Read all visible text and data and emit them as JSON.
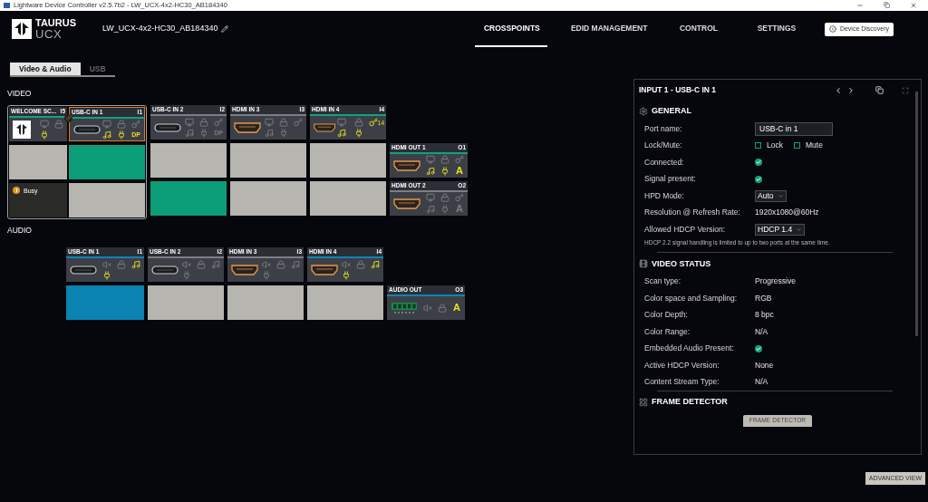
{
  "window": {
    "title": "Lightware Device Controller v2.5.7b2 - LW_UCX-4x2-HC30_AB184340"
  },
  "header": {
    "logo_top": "TAURUS",
    "logo_bottom": "UCX",
    "device_name": "LW_UCX-4x2-HC30_AB184340",
    "nav": [
      {
        "label": "CROSSPOINTS",
        "selected": true
      },
      {
        "label": "EDID MANAGEMENT",
        "selected": false
      },
      {
        "label": "CONTROL",
        "selected": false
      },
      {
        "label": "SETTINGS",
        "selected": false
      }
    ],
    "discovery_button": "Device Discovery"
  },
  "sub_tabs": [
    {
      "label": "Video & Audio",
      "selected": true
    },
    {
      "label": "USB",
      "selected": false
    }
  ],
  "video": {
    "label": "VIDEO",
    "inputs": [
      {
        "name": "WELCOME SC...",
        "id": "I5",
        "kind": "welcome",
        "signal": true,
        "selected": false,
        "icons": [
          {
            "kind": "monitor",
            "on": false
          },
          {
            "kind": "lock",
            "on": false
          },
          {
            "kind": "plug",
            "on": true
          }
        ]
      },
      {
        "name": "USB-C IN 1",
        "id": "I1",
        "kind": "usbc",
        "signal": true,
        "selected": true,
        "icons": [
          {
            "kind": "monitor",
            "on": false
          },
          {
            "kind": "lock",
            "on": false
          },
          {
            "kind": "key",
            "on": false
          },
          {
            "kind": "music",
            "on": true
          },
          {
            "kind": "plug",
            "on": true
          },
          {
            "kind": "dp",
            "on": true,
            "label": "DP"
          }
        ]
      },
      {
        "name": "USB-C IN 2",
        "id": "I2",
        "kind": "usbc",
        "signal": false,
        "selected": false,
        "icons": [
          {
            "kind": "monitor",
            "on": false
          },
          {
            "kind": "lock",
            "on": false
          },
          {
            "kind": "key",
            "on": false
          },
          {
            "kind": "music",
            "on": false
          },
          {
            "kind": "plug",
            "on": false
          },
          {
            "kind": "dp",
            "on": false,
            "label": "DP"
          }
        ]
      },
      {
        "name": "HDMI IN 3",
        "id": "I3",
        "kind": "hdmi",
        "signal": false,
        "selected": false,
        "icons": [
          {
            "kind": "monitor",
            "on": false
          },
          {
            "kind": "lock",
            "on": false
          },
          {
            "kind": "key",
            "on": false
          },
          {
            "kind": "music",
            "on": false
          },
          {
            "kind": "plug",
            "on": false
          }
        ]
      },
      {
        "name": "HDMI IN 4",
        "id": "I4",
        "kind": "hdmi",
        "signal": true,
        "selected": false,
        "icons": [
          {
            "kind": "monitor",
            "on": false
          },
          {
            "kind": "lock",
            "on": false
          },
          {
            "kind": "key",
            "on": true,
            "label": "14"
          },
          {
            "kind": "music",
            "on": true
          },
          {
            "kind": "plug",
            "on": true
          }
        ]
      }
    ],
    "outputs": [
      {
        "name": "HDMI OUT 1",
        "id": "O1",
        "kind": "hdmi",
        "signal": true,
        "selected": false,
        "icons": [
          {
            "kind": "monitor",
            "on": false
          },
          {
            "kind": "lock",
            "on": false
          },
          {
            "kind": "key",
            "on": false
          },
          {
            "kind": "music",
            "on": true
          },
          {
            "kind": "plug",
            "on": true
          },
          {
            "kind": "letter",
            "on": true,
            "label": "A"
          }
        ],
        "cells": [
          {
            "kind": "empty"
          },
          {
            "kind": "connected"
          },
          {
            "kind": "empty"
          },
          {
            "kind": "empty"
          },
          {
            "kind": "empty"
          }
        ]
      },
      {
        "name": "HDMI OUT 2",
        "id": "O2",
        "kind": "hdmi",
        "signal": false,
        "selected": false,
        "icons": [
          {
            "kind": "monitor",
            "on": false
          },
          {
            "kind": "lock",
            "on": false
          },
          {
            "kind": "key",
            "on": false
          },
          {
            "kind": "music",
            "on": false
          },
          {
            "kind": "plug",
            "on": false
          },
          {
            "kind": "letter",
            "on": false,
            "label": "A"
          }
        ],
        "cells": [
          {
            "kind": "busy",
            "label": "Busy"
          },
          {
            "kind": "empty"
          },
          {
            "kind": "connected"
          },
          {
            "kind": "empty"
          },
          {
            "kind": "empty"
          }
        ]
      }
    ]
  },
  "audio": {
    "label": "AUDIO",
    "inputs": [
      {
        "name": "USB-C IN 1",
        "id": "I1",
        "kind": "usbc",
        "signal": true,
        "selected": false,
        "icons": [
          {
            "kind": "mute",
            "on": false
          },
          {
            "kind": "lock",
            "on": false
          },
          {
            "kind": "music",
            "on": true
          },
          {
            "kind": "plug",
            "on": true
          }
        ]
      },
      {
        "name": "USB-C IN 2",
        "id": "I2",
        "kind": "usbc",
        "signal": false,
        "selected": false,
        "icons": [
          {
            "kind": "mute",
            "on": false
          },
          {
            "kind": "lock",
            "on": false
          },
          {
            "kind": "music",
            "on": false
          },
          {
            "kind": "plug",
            "on": false
          }
        ]
      },
      {
        "name": "HDMI IN 3",
        "id": "I3",
        "kind": "hdmi",
        "signal": false,
        "selected": false,
        "icons": [
          {
            "kind": "mute",
            "on": false
          },
          {
            "kind": "lock",
            "on": false
          },
          {
            "kind": "music",
            "on": false
          },
          {
            "kind": "plug",
            "on": false
          }
        ]
      },
      {
        "name": "HDMI IN 4",
        "id": "I4",
        "kind": "hdmi",
        "signal": true,
        "selected": false,
        "icons": [
          {
            "kind": "mute",
            "on": false
          },
          {
            "kind": "lock",
            "on": false
          },
          {
            "kind": "music",
            "on": true
          },
          {
            "kind": "plug",
            "on": true
          }
        ]
      }
    ],
    "outputs": [
      {
        "name": "AUDIO OUT",
        "id": "O3",
        "kind": "terminal",
        "signal": true,
        "selected": false,
        "icons": [
          {
            "kind": "mute",
            "on": false
          },
          {
            "kind": "lock",
            "on": false
          },
          {
            "kind": "letter",
            "on": true,
            "label": "A"
          }
        ],
        "cells": [
          {
            "kind": "connected"
          },
          {
            "kind": "empty"
          },
          {
            "kind": "empty"
          },
          {
            "kind": "empty"
          }
        ]
      }
    ]
  },
  "panel": {
    "title": "INPUT 1 - USB-C IN 1",
    "sections": [
      {
        "kind": "general",
        "title": "GENERAL",
        "rows": [
          {
            "kind": "input",
            "label": "Port name:",
            "value": "USB-C in 1"
          },
          {
            "kind": "checkboxes",
            "label": "Lock/Mute:",
            "options": [
              {
                "label": "Lock",
                "checked": false
              },
              {
                "label": "Mute",
                "checked": false
              }
            ]
          },
          {
            "kind": "status",
            "label": "Connected:",
            "on": true
          },
          {
            "kind": "status",
            "label": "Signal present:",
            "on": true
          },
          {
            "kind": "select",
            "label": "HPD Mode:",
            "value": "Auto"
          },
          {
            "kind": "text",
            "label": "Resolution @ Refresh Rate:",
            "value": "1920x1080@60Hz"
          },
          {
            "kind": "select",
            "label": "Allowed HDCP Version:",
            "value": "HDCP 1.4"
          }
        ],
        "note": "HDCP 2.2 signal handling is limited to up to two ports at the same time."
      },
      {
        "kind": "video",
        "title": "VIDEO STATUS",
        "rows": [
          {
            "kind": "text",
            "label": "Scan type:",
            "value": "Progressive"
          },
          {
            "kind": "text",
            "label": "Color space and Sampling:",
            "value": "RGB"
          },
          {
            "kind": "text",
            "label": "Color Depth:",
            "value": "8 bpc"
          },
          {
            "kind": "text",
            "label": "Color Range:",
            "value": "N/A"
          },
          {
            "kind": "status",
            "label": "Embedded Audio Present:",
            "on": true
          },
          {
            "kind": "text",
            "label": "Active HDCP Version:",
            "value": "None"
          },
          {
            "kind": "text",
            "label": "Content Stream Type:",
            "value": "N/A"
          }
        ]
      },
      {
        "kind": "frame",
        "title": "FRAME DETECTOR",
        "button": "FRAME DETECTOR"
      }
    ]
  },
  "advanced_button": "ADVANCED VIEW"
}
